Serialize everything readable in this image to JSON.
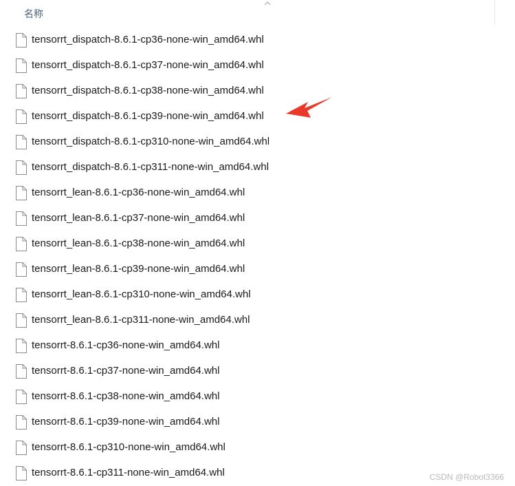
{
  "header": {
    "name_column_label": "名称",
    "sort_icon": "chevron-up-icon"
  },
  "files": [
    {
      "name": "tensorrt_dispatch-8.6.1-cp36-none-win_amd64.whl",
      "icon": "file-icon"
    },
    {
      "name": "tensorrt_dispatch-8.6.1-cp37-none-win_amd64.whl",
      "icon": "file-icon"
    },
    {
      "name": "tensorrt_dispatch-8.6.1-cp38-none-win_amd64.whl",
      "icon": "file-icon"
    },
    {
      "name": "tensorrt_dispatch-8.6.1-cp39-none-win_amd64.whl",
      "icon": "file-icon"
    },
    {
      "name": "tensorrt_dispatch-8.6.1-cp310-none-win_amd64.whl",
      "icon": "file-icon"
    },
    {
      "name": "tensorrt_dispatch-8.6.1-cp311-none-win_amd64.whl",
      "icon": "file-icon"
    },
    {
      "name": "tensorrt_lean-8.6.1-cp36-none-win_amd64.whl",
      "icon": "file-icon"
    },
    {
      "name": "tensorrt_lean-8.6.1-cp37-none-win_amd64.whl",
      "icon": "file-icon"
    },
    {
      "name": "tensorrt_lean-8.6.1-cp38-none-win_amd64.whl",
      "icon": "file-icon"
    },
    {
      "name": "tensorrt_lean-8.6.1-cp39-none-win_amd64.whl",
      "icon": "file-icon"
    },
    {
      "name": "tensorrt_lean-8.6.1-cp310-none-win_amd64.whl",
      "icon": "file-icon"
    },
    {
      "name": "tensorrt_lean-8.6.1-cp311-none-win_amd64.whl",
      "icon": "file-icon"
    },
    {
      "name": "tensorrt-8.6.1-cp36-none-win_amd64.whl",
      "icon": "file-icon"
    },
    {
      "name": "tensorrt-8.6.1-cp37-none-win_amd64.whl",
      "icon": "file-icon"
    },
    {
      "name": "tensorrt-8.6.1-cp38-none-win_amd64.whl",
      "icon": "file-icon"
    },
    {
      "name": "tensorrt-8.6.1-cp39-none-win_amd64.whl",
      "icon": "file-icon"
    },
    {
      "name": "tensorrt-8.6.1-cp310-none-win_amd64.whl",
      "icon": "file-icon"
    },
    {
      "name": "tensorrt-8.6.1-cp311-none-win_amd64.whl",
      "icon": "file-icon"
    }
  ],
  "annotation": {
    "arrow_icon": "red-arrow-icon",
    "arrow_color": "#e8392b"
  },
  "watermark": {
    "text": "CSDN @Robot3366"
  },
  "colors": {
    "header_text": "#4c607a",
    "file_text": "#1a1a1a",
    "icon_stroke": "#8a8a8a"
  }
}
